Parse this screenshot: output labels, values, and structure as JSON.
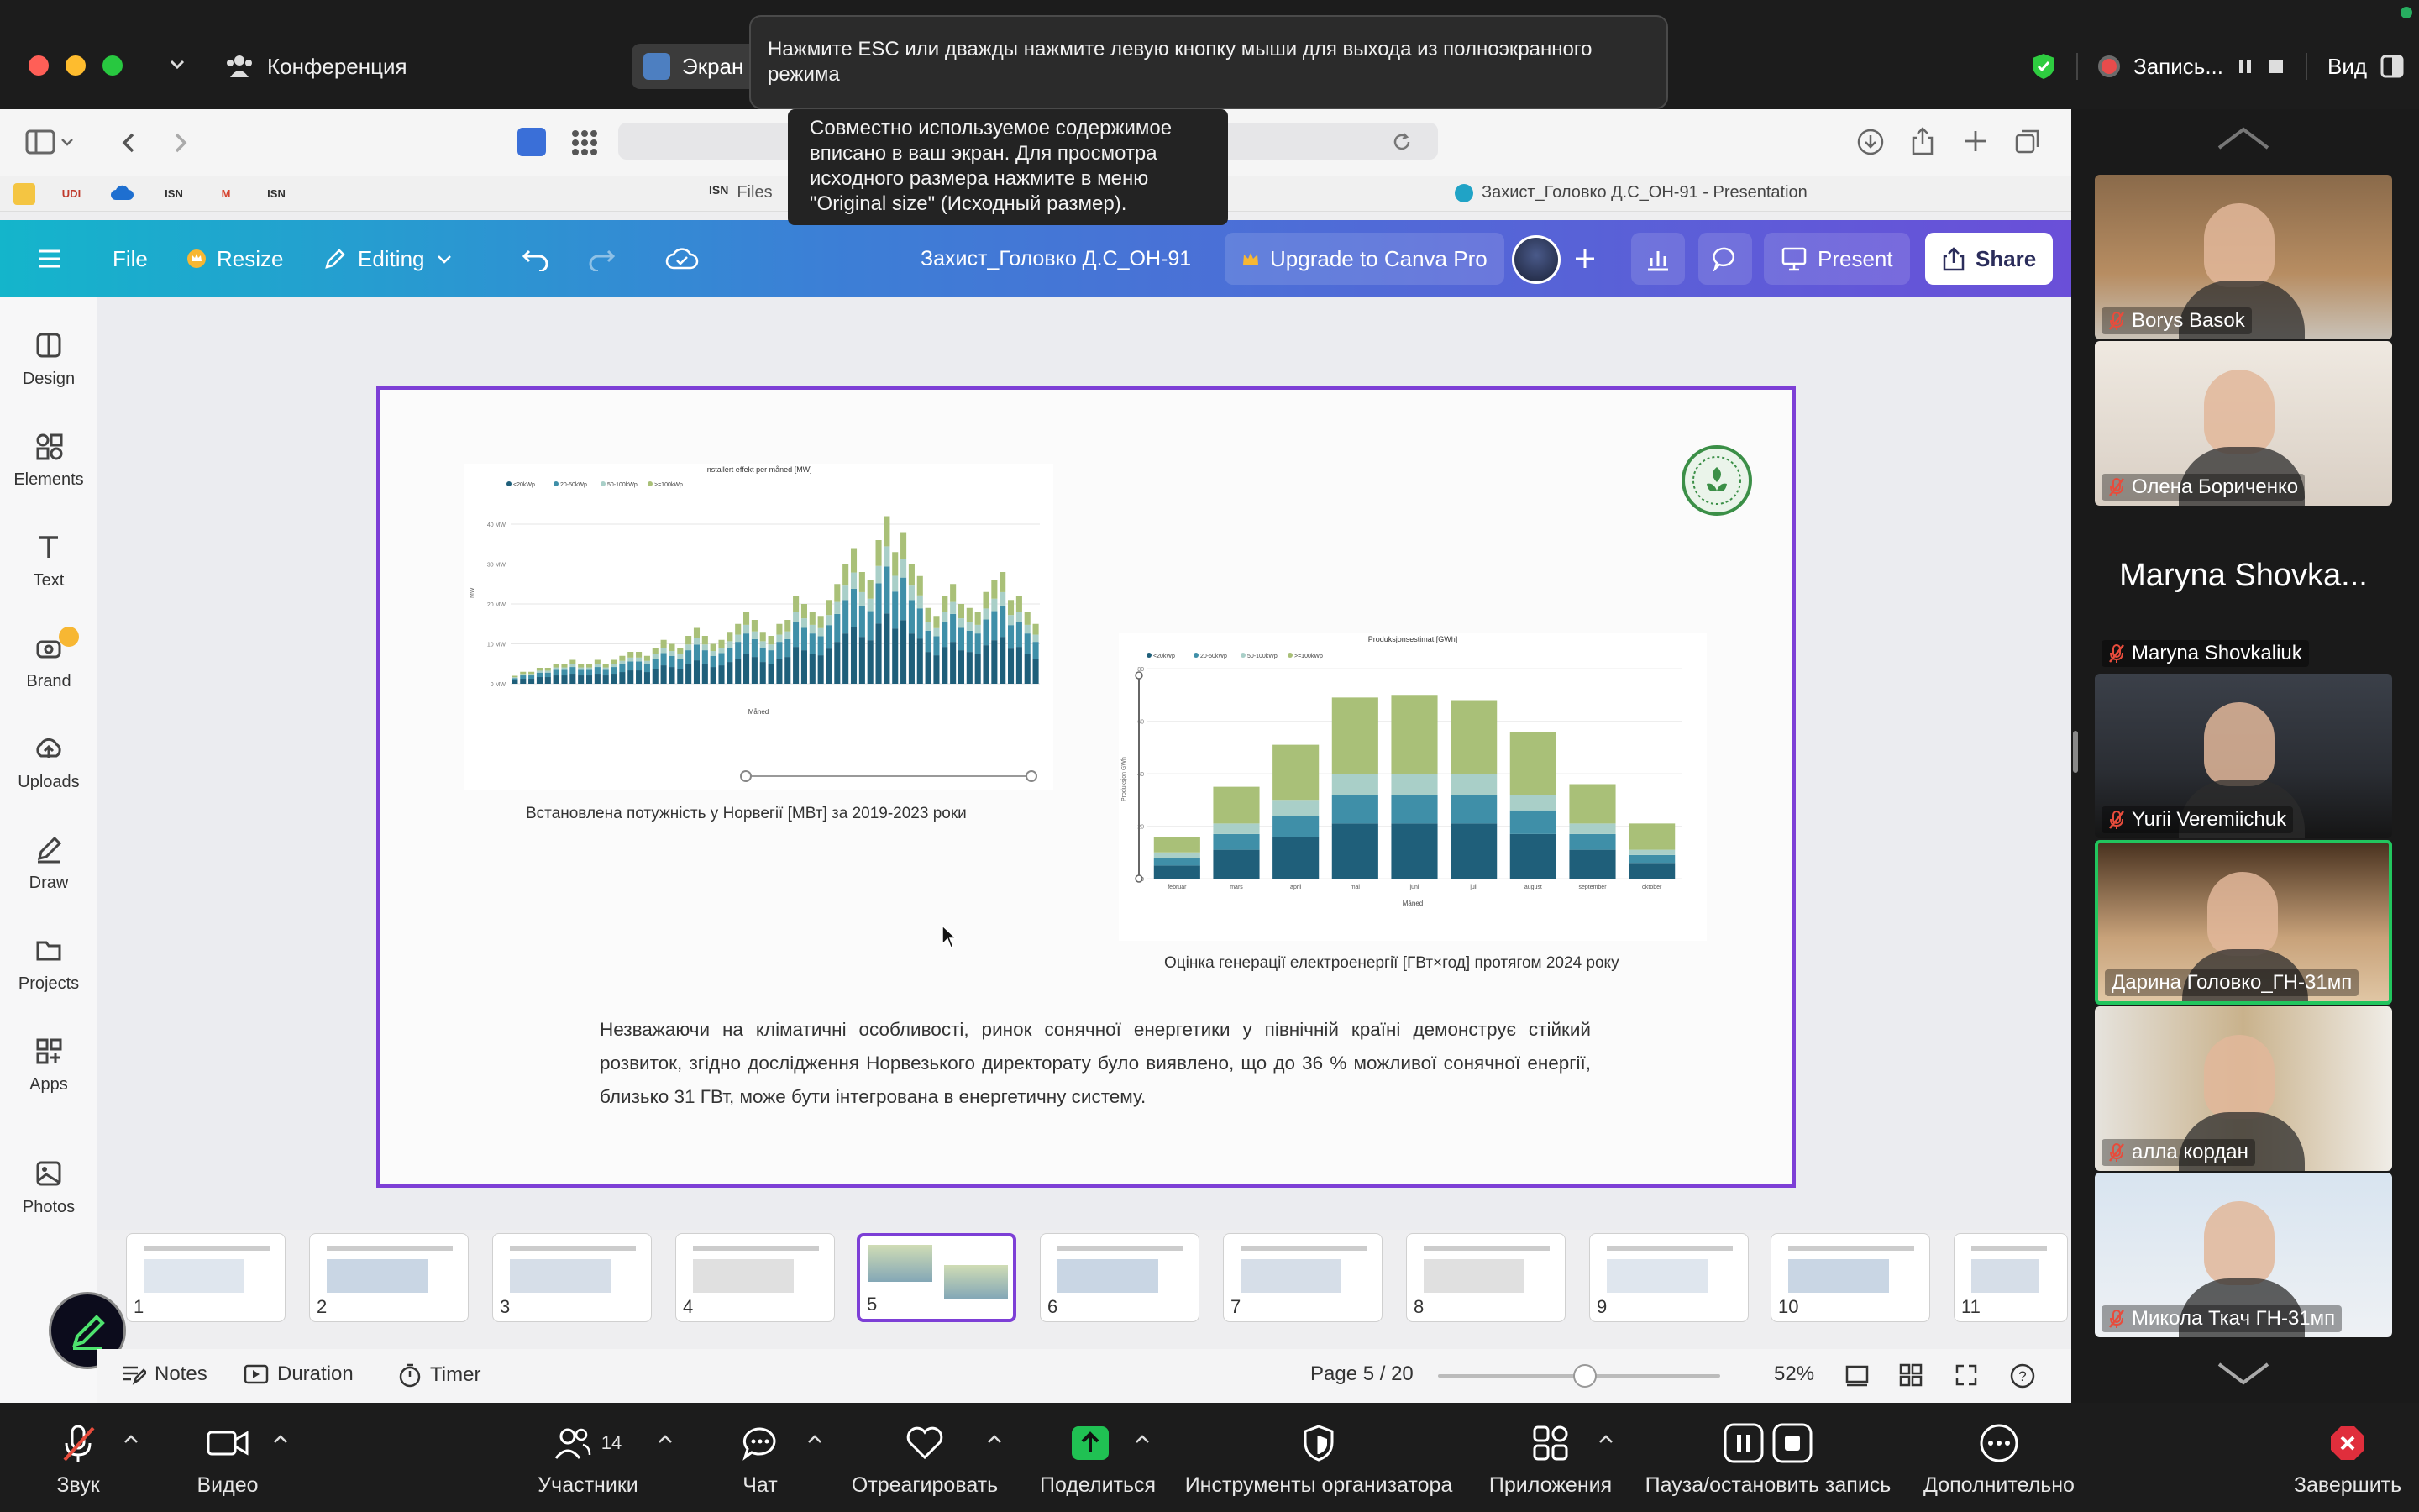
{
  "zoom_top": {
    "conference_label": "Конференция",
    "screen_tab_label": "Экран",
    "fullscreen_tip": "Нажмите ESC или дважды нажмите левую кнопку мыши для выхода из полноэкранного режима",
    "fit_tip": "Совместно используемое содержимое вписано в ваш экран. Для просмотра исходного размера нажмите в меню \"Original size\" (Исходный размер).",
    "record_label": "Запись...",
    "view_label": "Вид"
  },
  "browser": {
    "tab_files": "Files",
    "tab_title": "Захист_Головко Д.С_ОН-91 - Presentation",
    "bookmarks": [
      "UDI",
      "ISN",
      "ISN",
      "ISN"
    ]
  },
  "canva": {
    "menu": {
      "file": "File",
      "resize": "Resize",
      "editing": "Editing"
    },
    "doc_title": "Захист_Головко Д.С_ОН-91",
    "upgrade": "Upgrade to Canva Pro",
    "present": "Present",
    "share": "Share",
    "rail": [
      "Design",
      "Elements",
      "Text",
      "Brand",
      "Uploads",
      "Draw",
      "Projects",
      "Apps",
      "Photos"
    ],
    "slide": {
      "left_chart_title": "Installert effekt per måned [MW]",
      "left_caption": "Встановлена потужність у Норвегії [МВт] за 2019-2023 роки",
      "right_chart_title": "Produksjonsestimat [GWh]",
      "right_caption": "Оцінка генерації електроенергії [ГВт×год] протягом 2024 року",
      "body": "Незважаючи на кліматичні особливості, ринок сонячної енергетики у північній країні демонструє стійкий розвиток, згідно дослідження Норвезького директорату було виявлено, що до 36 % можливої сонячної енергії, близько 31 ГВт, може бути інтегрована в енергетичну систему."
    },
    "thumbnails": [
      "1",
      "2",
      "3",
      "4",
      "5",
      "6",
      "7",
      "8",
      "9",
      "10",
      "11"
    ],
    "bottom": {
      "notes": "Notes",
      "duration": "Duration",
      "timer": "Timer",
      "page": "Page 5 / 20",
      "zoom": "52%",
      "zoom_level": 0.52
    }
  },
  "chart_data": [
    {
      "type": "bar",
      "title": "Installert effekt per måned [MW]",
      "xlabel": "Måned",
      "ylabel": "MW",
      "ylim": [
        0,
        40
      ],
      "legend": "top-left",
      "series_names": [
        "<20kWp",
        "20-50kWp",
        "50-100kWp",
        ">=100kWp"
      ],
      "values": [
        2,
        3,
        3,
        4,
        4,
        5,
        5,
        6,
        5,
        5,
        6,
        5,
        6,
        7,
        8,
        8,
        7,
        9,
        11,
        10,
        9,
        12,
        14,
        12,
        10,
        11,
        13,
        15,
        18,
        16,
        13,
        12,
        15,
        16,
        22,
        20,
        18,
        17,
        21,
        25,
        30,
        34,
        28,
        26,
        36,
        42,
        33,
        38,
        30,
        27,
        19,
        17,
        22,
        25,
        20,
        19,
        18,
        23,
        26,
        28,
        21,
        22,
        18,
        15
      ]
    },
    {
      "type": "bar",
      "title": "Produksjonsestimat [GWh]",
      "xlabel": "Måned",
      "ylabel": "Produksjon GWh",
      "ylim": [
        0,
        80
      ],
      "categories": [
        "februar",
        "mars",
        "april",
        "mai",
        "juni",
        "juli",
        "august",
        "september",
        "oktober"
      ],
      "series": [
        {
          "name": "<20kWp",
          "values": [
            5,
            11,
            16,
            21,
            21,
            21,
            17,
            11,
            6
          ]
        },
        {
          "name": "20-50kWp",
          "values": [
            3,
            6,
            8,
            11,
            11,
            11,
            9,
            6,
            3
          ]
        },
        {
          "name": "50-100kWp",
          "values": [
            2,
            4,
            6,
            8,
            8,
            8,
            6,
            4,
            2
          ]
        },
        {
          "name": ">=100kWp",
          "values": [
            6,
            14,
            21,
            29,
            30,
            28,
            24,
            15,
            10
          ]
        }
      ]
    }
  ],
  "participants": [
    {
      "name": "Borys Basok",
      "muted": true
    },
    {
      "name": "Олена Бориченко",
      "muted": true
    },
    {
      "name": "Maryna Shovkaliuk",
      "display": "Maryna Shovka...",
      "muted": true
    },
    {
      "name": "Yurii Veremiichuk",
      "muted": true
    },
    {
      "name": "Дарина Головко_ГН-31мп",
      "muted": false,
      "active": true
    },
    {
      "name": "алла кордан",
      "muted": true
    },
    {
      "name": "Микола Ткач ГН-31мп",
      "muted": true
    }
  ],
  "zoom_bottom": {
    "audio": "Звук",
    "video": "Видео",
    "participants": "Участники",
    "participants_count": "14",
    "chat": "Чат",
    "react": "Отреагировать",
    "share": "Поделиться",
    "host_tools": "Инструменты организатора",
    "apps": "Приложения",
    "pause_record": "Пауза/остановить запись",
    "more": "Дополнительно",
    "end": "Завершить"
  },
  "colors": {
    "canva_purple": "#7d3fd6",
    "zoom_green": "#27ae60",
    "bar_dark": "#1f5f7a",
    "bar_mid": "#3f8fa8",
    "bar_light": "#a9cfc8",
    "bar_top": "#a9c078"
  }
}
